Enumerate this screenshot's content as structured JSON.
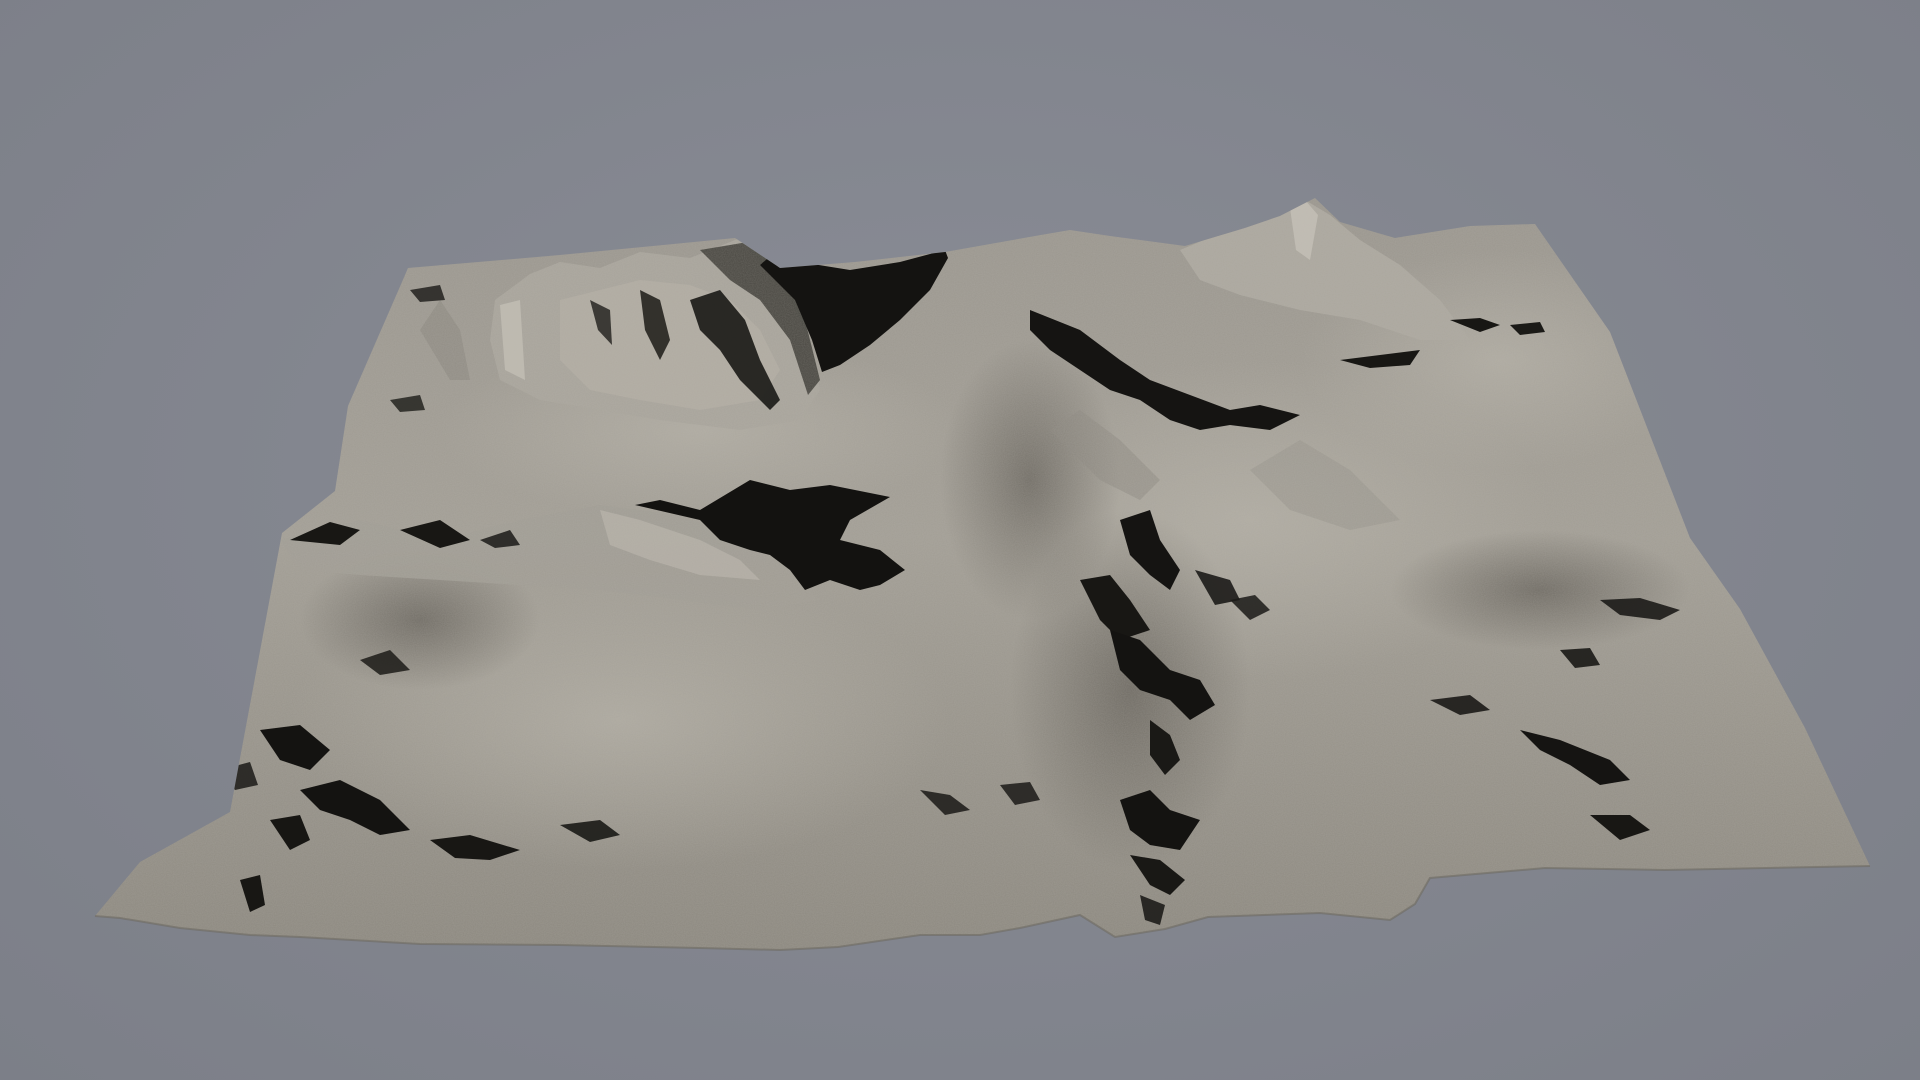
{
  "scene": {
    "subject": "terrain-mesh",
    "colors": {
      "background": "#83868f",
      "terrain_light": "#a9a59c",
      "terrain_mid": "#8f8b82",
      "terrain_dark": "#6f6b63",
      "shadow": "#151412"
    }
  }
}
